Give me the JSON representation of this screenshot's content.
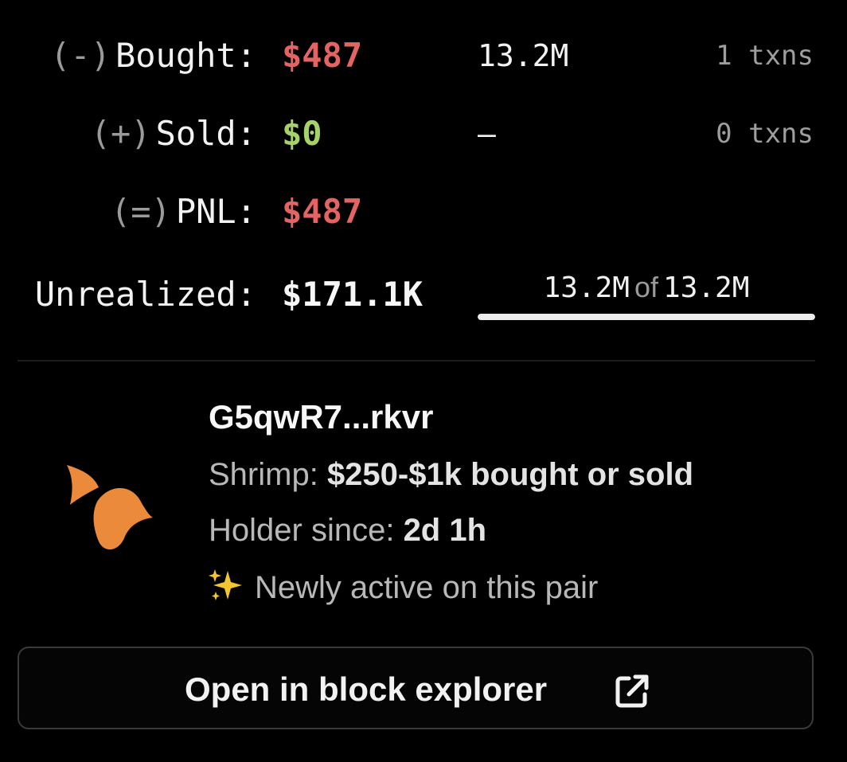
{
  "stats": {
    "bought": {
      "sign": "(-)",
      "label": "Bought:",
      "value": "$487",
      "amount": "13.2M",
      "txns": "1 txns",
      "color": "#e46464"
    },
    "sold": {
      "sign": "(+)",
      "label": "Sold:",
      "value": "$0",
      "amount": "–",
      "txns": "0 txns",
      "color": "#a6d26a"
    },
    "pnl": {
      "sign": "(=)",
      "label": "PNL:",
      "value": "$487",
      "color": "#e46464"
    },
    "unrealized": {
      "label": "Unrealized:",
      "value": "$171.1K",
      "held": "13.2M",
      "of_word": "of",
      "total": "13.2M",
      "held_fraction": 1.0
    }
  },
  "wallet": {
    "address": "G5qwR7...rkvr",
    "avatar_icon": "orange-butterfly-icon",
    "avatar_color": "#ec8a3c",
    "tier_label": "Shrimp:",
    "tier_value": "$250-$1k bought or sold",
    "since_label": "Holder since:",
    "since_value": "2d 1h",
    "activity_icon": "sparkles-icon",
    "activity_text": "Newly active on this pair"
  },
  "explorer_button": {
    "label": "Open in block explorer",
    "icon": "external-link-icon"
  }
}
